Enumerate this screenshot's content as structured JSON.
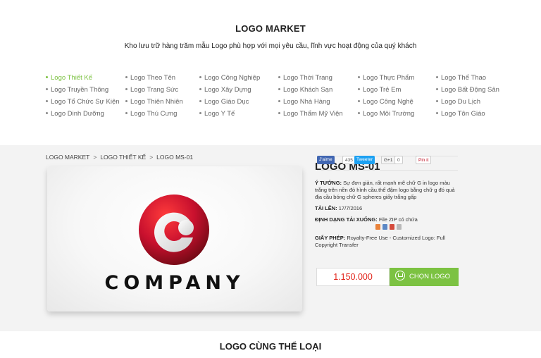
{
  "header": {
    "title": "LOGO MARKET",
    "subtitle": "Kho lưu trữ hàng trăm mẫu Logo phù hợp với mọi yêu cầu, lĩnh vực hoạt động của quý khách"
  },
  "categories": {
    "col1": [
      "Logo Thiết Kế",
      "Logo Truyền Thông",
      "Logo Tổ Chức Sự Kiện",
      "Logo Dinh Dưỡng"
    ],
    "col2": [
      "Logo Theo Tên",
      "Logo Trang Sức",
      "Logo Thiên Nhiên",
      "Logo Thú Cưng"
    ],
    "col3": [
      "Logo Công Nghiệp",
      "Logo Xây Dựng",
      "Logo Giáo Dục",
      "Logo Y Tế"
    ],
    "col4": [
      "Logo Thời Trang",
      "Logo Khách Sạn",
      "Logo Nhà Hàng",
      "Logo Thẩm Mỹ Viện"
    ],
    "col5": [
      "Logo Thực Phẩm",
      "Logo Trẻ Em",
      "Logo Công Nghệ",
      "Logo Môi Trường"
    ],
    "col6": [
      "Logo Thể Thao",
      "Logo Bất Động Sản",
      "Logo Du Lịch",
      "Logo Tôn Giáo"
    ],
    "active": "Logo Thiết Kế"
  },
  "breadcrumb": [
    "LOGO MARKET",
    "LOGO THIẾT KẾ",
    "LOGO MS-01"
  ],
  "breadcrumb_sep": ">",
  "product": {
    "image_text": "COMPANY",
    "title": "LOGO MS-01",
    "idea_label": "Ý TƯỞNG:",
    "idea": "Sự đơn giản, rất mạnh mẽ chữ G in logo màu trắng trên nền đỏ hình cầu.thể đậm logo bằng chữ g đó quả địa cầu bóng chữ G spheres giấy trắng gấp",
    "uploaded_label": "TẢI LÊN:",
    "uploaded": "17/7/2016",
    "format_label": "ĐỊNH DẠNG TẢI XUỐNG:",
    "format": "File ZIP có chứa",
    "license_label": "GIẤY PHÉP:",
    "license": "Royalty-Free Use - Customized Logo: Full Copyright Transfer",
    "price": "1.150.000",
    "buy_label": "CHỌN LOGO"
  },
  "share": {
    "facebook": "J'aime",
    "facebook_count": "435",
    "twitter": "Tweeter",
    "gplus": "G+1",
    "gplus_count": "0",
    "pinterest": "Pin it"
  },
  "related_title": "LOGO CÙNG THỂ LOẠI",
  "colors": {
    "accent": "#7cc242",
    "price": "#e2231a",
    "logo_red": "#c8102e"
  }
}
